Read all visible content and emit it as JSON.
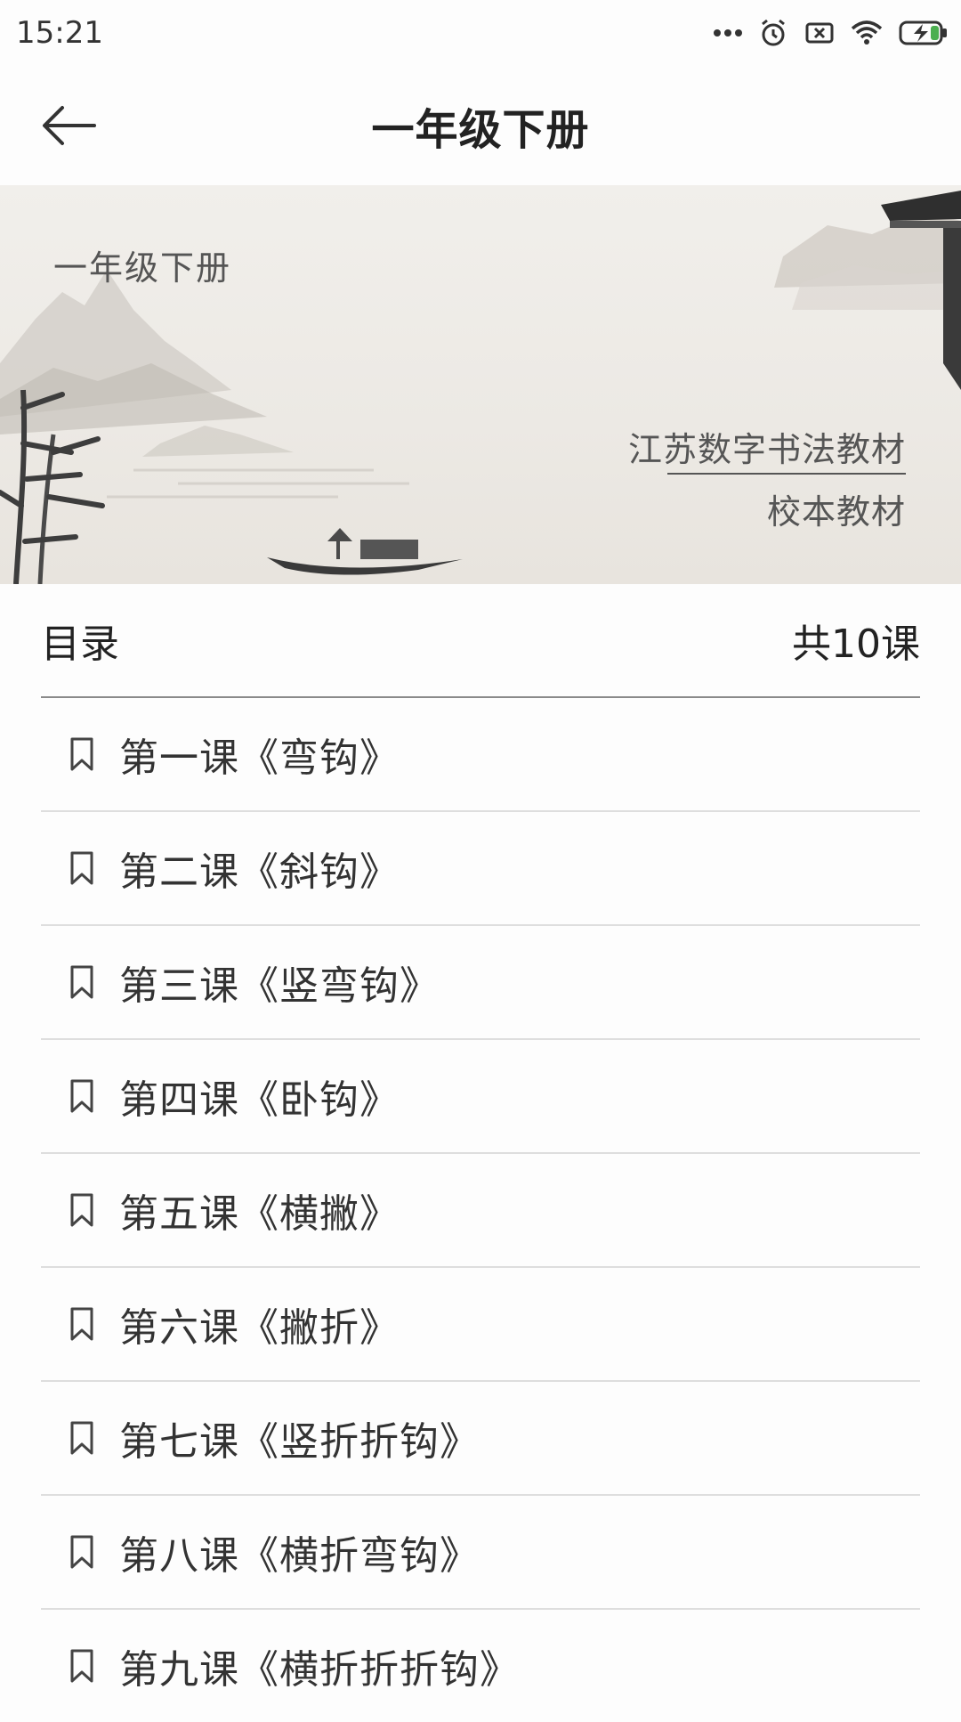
{
  "status_bar": {
    "time": "15:21",
    "icons": [
      "more-dots-icon",
      "alarm-icon",
      "notification-box-icon",
      "wifi-icon",
      "battery-charging-icon"
    ]
  },
  "header": {
    "title": "一年级下册",
    "back_icon": "arrow-left-icon"
  },
  "banner": {
    "title": "一年级下册",
    "subtitle_1": "江苏数字书法教材",
    "subtitle_2": "校本教材"
  },
  "toc": {
    "label": "目录",
    "count": "共10课"
  },
  "lessons": [
    {
      "label": "第一课《弯钩》"
    },
    {
      "label": "第二课《斜钩》"
    },
    {
      "label": "第三课《竖弯钩》"
    },
    {
      "label": "第四课《卧钩》"
    },
    {
      "label": "第五课《横撇》"
    },
    {
      "label": "第六课《撇折》"
    },
    {
      "label": "第七课《竖折折钩》"
    },
    {
      "label": "第八课《横折弯钩》"
    },
    {
      "label": "第九课《横折折折钩》"
    }
  ],
  "colors": {
    "background": "#fdfdfd",
    "text": "#333333",
    "divider": "#dedede",
    "battery_accent": "#4caf50"
  }
}
